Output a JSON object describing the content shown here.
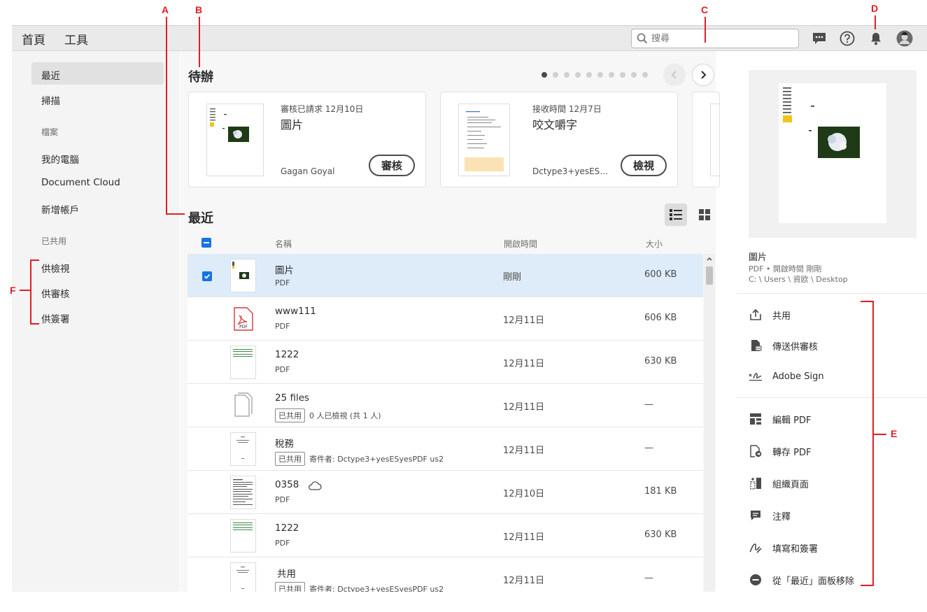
{
  "tabs": {
    "home": "首頁",
    "tools": "工具"
  },
  "search": {
    "placeholder": "搜尋"
  },
  "sidebar": {
    "recent": "最近",
    "scan": "掃描",
    "files_header": "檔案",
    "my_computer": "我的電腦",
    "document_cloud": "Document Cloud",
    "add_account": "新增帳戶",
    "shared_header": "已共用",
    "for_review_view": "供檢視",
    "for_review": "供審核",
    "for_sign": "供簽署"
  },
  "todo": {
    "title": "待辦",
    "dot_count": 10,
    "cards": [
      {
        "meta": "審核已請求 12月10日",
        "title": "圖片",
        "who": "Gagan Goyal",
        "action": "審核"
      },
      {
        "meta": "接收時間 12月7日",
        "title": "咬文嚼字",
        "who": "Dctype3+yesESyes…",
        "action": "檢視"
      }
    ]
  },
  "recent": {
    "title": "最近",
    "columns": {
      "name": "名稱",
      "opened": "開啟時間",
      "size": "大小"
    },
    "rows": [
      {
        "name": "圖片",
        "sub": "PDF",
        "badge": "",
        "date": "剛剛",
        "size": "600 KB",
        "selected": true
      },
      {
        "name": "www111",
        "sub": "PDF",
        "badge": "",
        "date": "12月11日",
        "size": "606 KB",
        "selected": false
      },
      {
        "name": "1222",
        "sub": "PDF",
        "badge": "",
        "date": "12月11日",
        "size": "630 KB",
        "selected": false
      },
      {
        "name": "25 files",
        "sub": "0 人已檢視 (共 1 人)",
        "badge": "已共用",
        "date": "12月11日",
        "size": "—",
        "selected": false
      },
      {
        "name": "稅務",
        "sub": "寄件者: Dctype3+yesESyesPDF us2",
        "badge": "已共用",
        "date": "12月11日",
        "size": "—",
        "selected": false
      },
      {
        "name": "0358",
        "sub": "PDF",
        "badge": "",
        "date": "12月10日",
        "size": "181 KB",
        "selected": false
      },
      {
        "name": "1222",
        "sub": "PDF",
        "badge": "",
        "date": "12月11日",
        "size": "630 KB",
        "selected": false
      },
      {
        "name": "共用",
        "sub": "寄件者: Dctype3+yesESyesPDF us2",
        "badge": "已共用",
        "date": "12月11日",
        "size": "—",
        "selected": false
      }
    ]
  },
  "pdf_icon_label": "PDF",
  "right_panel": {
    "file_name": "圖片",
    "file_meta": "PDF • 開啟時間 剛剛",
    "file_path": "C: \\ Users \\ 資欧 \\ Desktop",
    "actions_top": [
      {
        "label": "共用",
        "icon": "share-icon"
      },
      {
        "label": "傳送供審核",
        "icon": "send-review-icon"
      },
      {
        "label": "Adobe Sign",
        "icon": "adobe-sign-icon"
      }
    ],
    "actions_bottom": [
      {
        "label": "編輯 PDF",
        "icon": "edit-pdf-icon"
      },
      {
        "label": "轉存 PDF",
        "icon": "export-pdf-icon"
      },
      {
        "label": "組織頁面",
        "icon": "organize-pages-icon"
      },
      {
        "label": "注釋",
        "icon": "comment-icon"
      },
      {
        "label": "填寫和簽署",
        "icon": "fill-sign-icon"
      },
      {
        "label": "從「最近」面板移除",
        "icon": "remove-icon"
      }
    ]
  },
  "annotations": {
    "a": "A",
    "b": "B",
    "c": "C",
    "d": "D",
    "e": "E",
    "f": "F"
  },
  "colors": {
    "accent": "#1473e6",
    "annotation": "#e01f26",
    "selected_row": "#deebf9"
  }
}
